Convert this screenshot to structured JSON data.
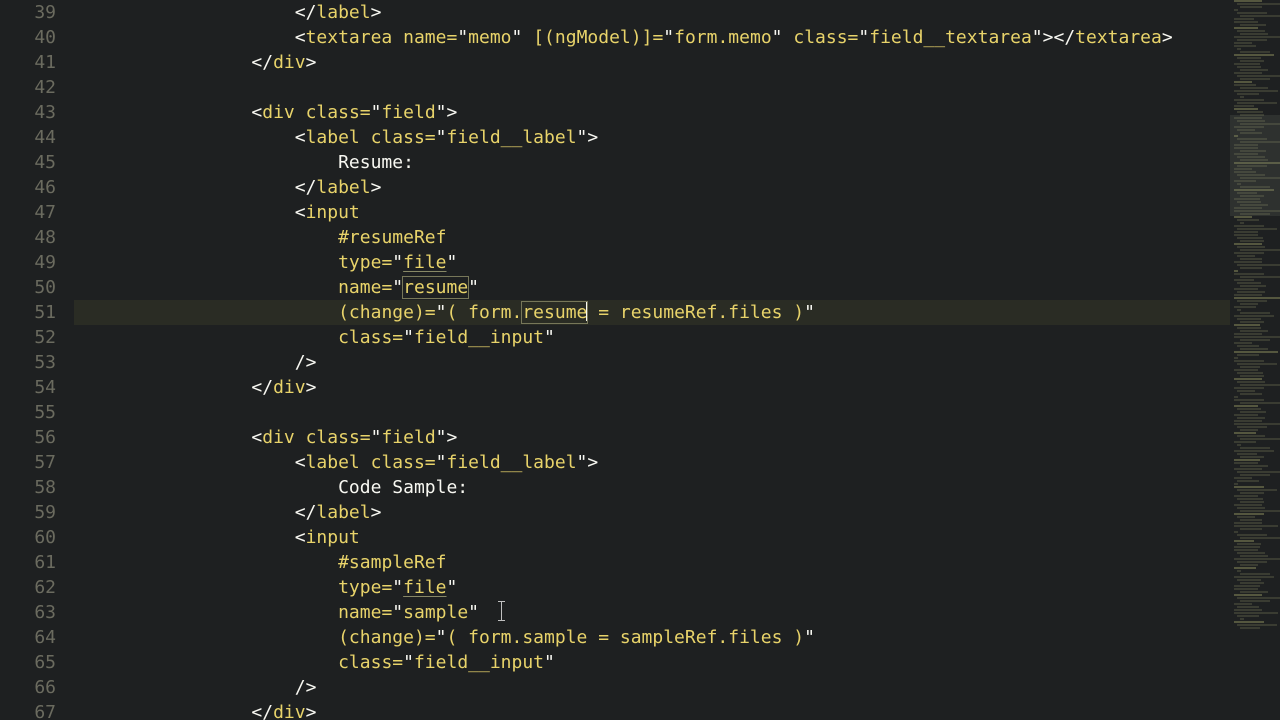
{
  "first_line_number": 39,
  "highlight_index": 12,
  "text_cursor": {
    "row_index": 24,
    "after_col_chars": 41
  },
  "minimap": {
    "total_lines": 210,
    "viewport_top_pct": 16,
    "viewport_height_pct": 14
  },
  "lines": [
    [
      [
        "pun",
        "                    </"
      ],
      [
        "tag",
        "label"
      ],
      [
        "pun",
        ">"
      ]
    ],
    [
      [
        "pun",
        "                    <"
      ],
      [
        "tag",
        "textarea"
      ],
      [
        "txt",
        " "
      ],
      [
        "attr",
        "name"
      ],
      [
        "eq",
        "="
      ],
      [
        "qd",
        "\""
      ],
      [
        "str",
        "memo"
      ],
      [
        "qd",
        "\""
      ],
      [
        "txt",
        " "
      ],
      [
        "attr",
        "[(ngModel)]"
      ],
      [
        "eq",
        "="
      ],
      [
        "qd",
        "\""
      ],
      [
        "str",
        "form.memo"
      ],
      [
        "qd",
        "\""
      ],
      [
        "txt",
        " "
      ],
      [
        "attr",
        "class"
      ],
      [
        "eq",
        "="
      ],
      [
        "qd",
        "\""
      ],
      [
        "str",
        "field__textarea"
      ],
      [
        "qd",
        "\""
      ],
      [
        "pun",
        "></"
      ],
      [
        "tag",
        "textarea"
      ],
      [
        "pun",
        ">"
      ]
    ],
    [
      [
        "pun",
        "                </"
      ],
      [
        "tag",
        "div"
      ],
      [
        "pun",
        ">"
      ]
    ],
    [
      [
        "txt",
        ""
      ]
    ],
    [
      [
        "pun",
        "                <"
      ],
      [
        "tag",
        "div"
      ],
      [
        "txt",
        " "
      ],
      [
        "attr",
        "class"
      ],
      [
        "eq",
        "="
      ],
      [
        "qd",
        "\""
      ],
      [
        "str",
        "field"
      ],
      [
        "qd",
        "\""
      ],
      [
        "pun",
        ">"
      ]
    ],
    [
      [
        "pun",
        "                    <"
      ],
      [
        "tag",
        "label"
      ],
      [
        "txt",
        " "
      ],
      [
        "attr",
        "class"
      ],
      [
        "eq",
        "="
      ],
      [
        "qd",
        "\""
      ],
      [
        "str",
        "field__label"
      ],
      [
        "qd",
        "\""
      ],
      [
        "pun",
        ">"
      ]
    ],
    [
      [
        "txt",
        "                        Resume:"
      ]
    ],
    [
      [
        "pun",
        "                    </"
      ],
      [
        "tag",
        "label"
      ],
      [
        "pun",
        ">"
      ]
    ],
    [
      [
        "pun",
        "                    <"
      ],
      [
        "tag",
        "input"
      ]
    ],
    [
      [
        "txt",
        "                        "
      ],
      [
        "attr",
        "#resumeRef"
      ]
    ],
    [
      [
        "txt",
        "                        "
      ],
      [
        "attr",
        "type"
      ],
      [
        "eq",
        "="
      ],
      [
        "qd",
        "\""
      ],
      [
        "str ul",
        "file"
      ],
      [
        "qd",
        "\""
      ]
    ],
    [
      [
        "txt",
        "                        "
      ],
      [
        "attr",
        "name"
      ],
      [
        "eq",
        "="
      ],
      [
        "qd",
        "\""
      ],
      [
        "str boxed",
        "resume"
      ],
      [
        "qd",
        "\""
      ]
    ],
    [
      [
        "txt",
        "                        "
      ],
      [
        "attr",
        "(change)"
      ],
      [
        "eq",
        "="
      ],
      [
        "qd",
        "\""
      ],
      [
        "str",
        "( form."
      ],
      [
        "str boxed",
        "resume"
      ],
      [
        "str",
        " = resumeRef.files )"
      ],
      [
        "qd",
        "\""
      ]
    ],
    [
      [
        "txt",
        "                        "
      ],
      [
        "attr",
        "class"
      ],
      [
        "eq",
        "="
      ],
      [
        "qd",
        "\""
      ],
      [
        "str",
        "field__input"
      ],
      [
        "qd",
        "\""
      ]
    ],
    [
      [
        "pun",
        "                    />"
      ]
    ],
    [
      [
        "pun",
        "                </"
      ],
      [
        "tag",
        "div"
      ],
      [
        "pun",
        ">"
      ]
    ],
    [
      [
        "txt",
        ""
      ]
    ],
    [
      [
        "pun",
        "                <"
      ],
      [
        "tag",
        "div"
      ],
      [
        "txt",
        " "
      ],
      [
        "attr",
        "class"
      ],
      [
        "eq",
        "="
      ],
      [
        "qd",
        "\""
      ],
      [
        "str",
        "field"
      ],
      [
        "qd",
        "\""
      ],
      [
        "pun",
        ">"
      ]
    ],
    [
      [
        "pun",
        "                    <"
      ],
      [
        "tag",
        "label"
      ],
      [
        "txt",
        " "
      ],
      [
        "attr",
        "class"
      ],
      [
        "eq",
        "="
      ],
      [
        "qd",
        "\""
      ],
      [
        "str",
        "field__label"
      ],
      [
        "qd",
        "\""
      ],
      [
        "pun",
        ">"
      ]
    ],
    [
      [
        "txt",
        "                        Code Sample:"
      ]
    ],
    [
      [
        "pun",
        "                    </"
      ],
      [
        "tag",
        "label"
      ],
      [
        "pun",
        ">"
      ]
    ],
    [
      [
        "pun",
        "                    <"
      ],
      [
        "tag",
        "input"
      ]
    ],
    [
      [
        "txt",
        "                        "
      ],
      [
        "attr",
        "#sampleRef"
      ]
    ],
    [
      [
        "txt",
        "                        "
      ],
      [
        "attr",
        "type"
      ],
      [
        "eq",
        "="
      ],
      [
        "qd",
        "\""
      ],
      [
        "str ul",
        "file"
      ],
      [
        "qd",
        "\""
      ]
    ],
    [
      [
        "txt",
        "                        "
      ],
      [
        "attr",
        "name"
      ],
      [
        "eq",
        "="
      ],
      [
        "qd",
        "\""
      ],
      [
        "str",
        "sample"
      ],
      [
        "qd",
        "\""
      ]
    ],
    [
      [
        "txt",
        "                        "
      ],
      [
        "attr",
        "(change)"
      ],
      [
        "eq",
        "="
      ],
      [
        "qd",
        "\""
      ],
      [
        "str",
        "( form.sample = sampleRef.files )"
      ],
      [
        "qd",
        "\""
      ]
    ],
    [
      [
        "txt",
        "                        "
      ],
      [
        "attr",
        "class"
      ],
      [
        "eq",
        "="
      ],
      [
        "qd",
        "\""
      ],
      [
        "str",
        "field__input"
      ],
      [
        "qd",
        "\""
      ]
    ],
    [
      [
        "pun",
        "                    />"
      ]
    ],
    [
      [
        "pun",
        "                </"
      ],
      [
        "tag",
        "div"
      ],
      [
        "pun",
        ">"
      ]
    ]
  ]
}
